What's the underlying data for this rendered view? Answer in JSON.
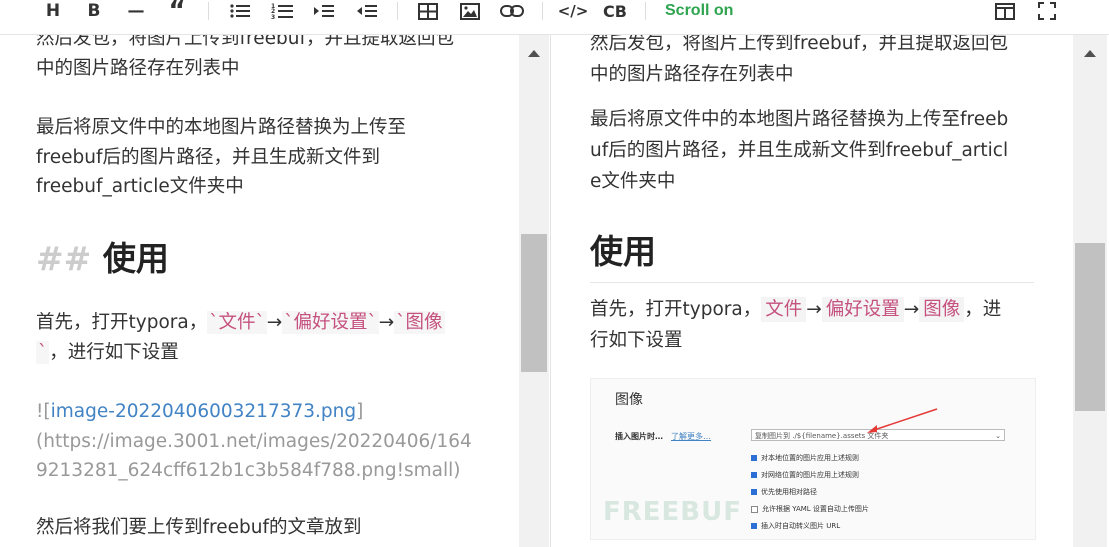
{
  "toolbar": {
    "scroll_label": "Scroll on",
    "tools": [
      {
        "name": "heading",
        "glyph": "H"
      },
      {
        "name": "bold",
        "glyph": "B"
      },
      {
        "name": "horizontal-rule",
        "glyph": "—"
      },
      {
        "name": "quote",
        "glyph": "“"
      },
      {
        "name": "unordered-list",
        "glyph": ""
      },
      {
        "name": "ordered-list",
        "glyph": ""
      },
      {
        "name": "indent",
        "glyph": ""
      },
      {
        "name": "outdent",
        "glyph": ""
      },
      {
        "name": "table",
        "glyph": ""
      },
      {
        "name": "image",
        "glyph": ""
      },
      {
        "name": "link",
        "glyph": ""
      },
      {
        "name": "code",
        "glyph": "</>"
      },
      {
        "name": "code-block",
        "glyph": "CB"
      }
    ]
  },
  "editor": {
    "p1_line1": "然后发包，将图片上传到freebuf，并且提取返回包",
    "p1_line2": "中的图片路径存在列表中",
    "p2_line1": "最后将原文件中的本地图片路径替换为上传至",
    "p2_line2": "freebuf后的图片路径，并且生成新文件到",
    "p2_line3": "freebuf_article文件夹中",
    "heading_marker": "##",
    "heading_text": "使用",
    "p3_prefix": "首先，打开typora，",
    "p3_code1": "`文件`",
    "arrow": "→",
    "p3_code2": "`偏好设置`",
    "p3_code3a": "`图像",
    "p3_code3b": "`",
    "p3_suffix": "，进行如下设置",
    "img_bang": "!",
    "img_open": "[",
    "img_alt": "image-20220406003217373.png",
    "img_close": "]",
    "img_url_line1": "(https://image.3001.net/images/20220406/164",
    "img_url_line2": "9213281_624cff612b1c3b584f788.png!small)",
    "p4": "然后将我们要上传到freebuf的文章放到"
  },
  "preview": {
    "p1_line1": "然后发包，将图片上传到freebuf，并且提取返回包",
    "p1_line2": "中的图片路径存在列表中",
    "p2_line1": "最后将原文件中的本地图片路径替换为上传至freeb",
    "p2_line2": "uf后的图片路径，并且生成新文件到freebuf_articl",
    "p2_line3": "e文件夹中",
    "heading": "使用",
    "p3_prefix": "首先，打开typora，",
    "code1": "文件",
    "arrow": "→",
    "code2": "偏好设置",
    "code3": "图像",
    "p3_comma": "，进",
    "p3_line2": "行如下设置",
    "image": {
      "title": "图像",
      "insert_label": "插入图片时…",
      "more_link": "了解更多…",
      "select_value": "复制图片到 ./${filename}.assets 文件夹",
      "options": [
        {
          "label": "对本地位置的图片应用上述规则",
          "checked": true
        },
        {
          "label": "对网络位置的图片应用上述规则",
          "checked": true
        },
        {
          "label": "优先使用相对路径",
          "checked": true
        },
        {
          "label": "允许根据 YAML 设置自动上传图片",
          "checked": false
        },
        {
          "label": "插入时自动转义图片 URL",
          "checked": true
        }
      ],
      "watermark": "FREEBUF"
    }
  },
  "colors": {
    "accent_green": "#2ea44f",
    "code_pink": "#c5517f",
    "link_blue": "#4183c4"
  }
}
